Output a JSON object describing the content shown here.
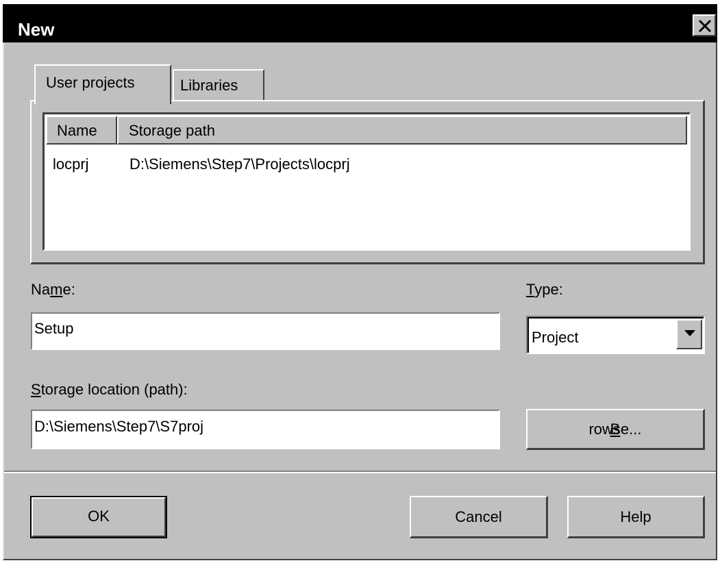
{
  "window": {
    "title": "New",
    "close_symbol": "close-icon"
  },
  "tabs": [
    {
      "label": "User projects",
      "selected": true
    },
    {
      "label": "Libraries",
      "selected": false
    }
  ],
  "list": {
    "columns": [
      "Name",
      "Storage path"
    ],
    "rows": [
      {
        "name": "locprj",
        "path": "D:\\Siemens\\Step7\\Projects\\locprj"
      }
    ]
  },
  "form": {
    "name_label_pre": "Na",
    "name_label_u": "m",
    "name_label_post": "e:",
    "name_value": "Setup",
    "type_label_u": "T",
    "type_label_post": "ype:",
    "type_value": "Project",
    "storage_label_u": "S",
    "storage_label_post": "torage location (path):",
    "storage_value": "D:\\Siemens\\Step7\\S7proj"
  },
  "buttons": {
    "browse_u": "B",
    "browse_post": "rowse...",
    "ok": "OK",
    "cancel": "Cancel",
    "help": "Help"
  },
  "colors": {
    "face": "#c0c0c0",
    "titlebar": "#000000",
    "title_text": "#ffffff"
  }
}
